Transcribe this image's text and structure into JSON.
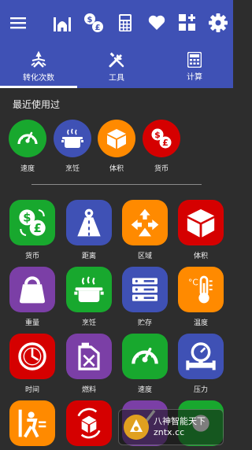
{
  "toolbar": {
    "icons": [
      "menu-icon",
      "mosque-icon",
      "currency-exchange-icon",
      "calculator-icon",
      "heart-icon",
      "widgets-icon",
      "settings-icon"
    ]
  },
  "tabs": [
    {
      "label": "转化次数",
      "icon": "conversions-icon",
      "selected": true
    },
    {
      "label": "工具",
      "icon": "tools-icon",
      "selected": false
    },
    {
      "label": "计算",
      "icon": "calculator-icon",
      "selected": false
    }
  ],
  "recent": {
    "title": "最近使用过",
    "items": [
      {
        "label": "速度",
        "icon": "speedometer-icon",
        "color": "#18a82e"
      },
      {
        "label": "烹饪",
        "icon": "cooking-pot-icon",
        "color": "#3f51b5"
      },
      {
        "label": "体积",
        "icon": "cube-icon",
        "color": "#ff8a00"
      },
      {
        "label": "货币",
        "icon": "currency-icon",
        "color": "#d50000"
      }
    ]
  },
  "grid": {
    "items": [
      {
        "label": "货币",
        "icon": "currency-icon",
        "color": "#18a82e"
      },
      {
        "label": "距离",
        "icon": "road-icon",
        "color": "#3f51b5"
      },
      {
        "label": "区域",
        "icon": "area-arrows-icon",
        "color": "#ff8a00"
      },
      {
        "label": "体积",
        "icon": "cube-icon",
        "color": "#d50000"
      },
      {
        "label": "重量",
        "icon": "weight-icon",
        "color": "#7b3fa6"
      },
      {
        "label": "烹饪",
        "icon": "cooking-pot-icon",
        "color": "#18a82e"
      },
      {
        "label": "贮存",
        "icon": "storage-icon",
        "color": "#3f51b5"
      },
      {
        "label": "温度",
        "icon": "thermometer-icon",
        "color": "#ff8a00"
      },
      {
        "label": "时间",
        "icon": "clock-icon",
        "color": "#d50000"
      },
      {
        "label": "燃料",
        "icon": "fuel-can-icon",
        "color": "#7b3fa6"
      },
      {
        "label": "速度",
        "icon": "speedometer-icon",
        "color": "#18a82e"
      },
      {
        "label": "压力",
        "icon": "pressure-gauge-icon",
        "color": "#3f51b5"
      },
      {
        "label": "",
        "icon": "force-icon",
        "color": "#ff8a00"
      },
      {
        "label": "",
        "icon": "rotate-cube-icon",
        "color": "#d50000"
      },
      {
        "label": "",
        "icon": "broom-icon",
        "color": "#7b3fa6"
      },
      {
        "label": "",
        "icon": "unknown-icon",
        "color": "#18a82e"
      }
    ]
  },
  "watermark": {
    "line1": "八神智能天下",
    "line2": "zntx.cc"
  }
}
